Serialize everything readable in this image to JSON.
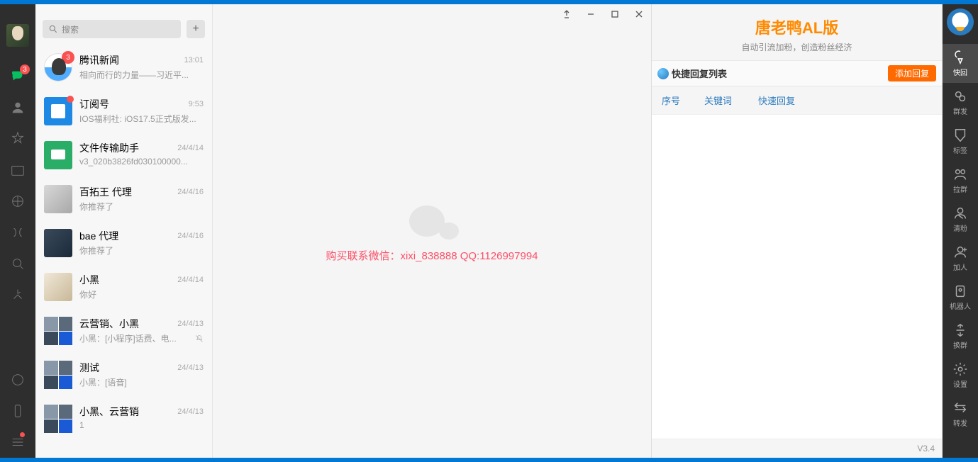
{
  "wechat_sidebar": {
    "chat_badge": "3"
  },
  "search": {
    "placeholder": "搜索"
  },
  "chats": [
    {
      "name": "腾讯新闻",
      "time": "13:01",
      "preview": "相向而行的力量——习近平...",
      "avatar": "qq",
      "badge": "3"
    },
    {
      "name": "订阅号",
      "time": "9:53",
      "preview": "IOS福利社: iOS17.5正式版发...",
      "avatar": "sub",
      "dot": true
    },
    {
      "name": "文件传输助手",
      "time": "24/4/14",
      "preview": "v3_020b3826fd030100000...",
      "avatar": "file"
    },
    {
      "name": "百拓王  代理",
      "time": "24/4/16",
      "preview": "你推荐了",
      "avatar": "photo1"
    },
    {
      "name": "bae  代理",
      "time": "24/4/16",
      "preview": "你推荐了",
      "avatar": "photo2"
    },
    {
      "name": "小黑",
      "time": "24/4/14",
      "preview": "你好",
      "avatar": "dog"
    },
    {
      "name": "云营销、小黑",
      "time": "24/4/13",
      "preview": "小黑：[小程序]话费、电...",
      "avatar": "grid",
      "mute": true
    },
    {
      "name": "测试",
      "time": "24/4/13",
      "preview": "小黑：[语音]",
      "avatar": "grid"
    },
    {
      "name": "小黑、云营销",
      "time": "24/4/13",
      "preview": "1",
      "avatar": "grid"
    }
  ],
  "watermark": "购买联系微信：xixi_838888    QQ:1126997994",
  "right_panel": {
    "title": "唐老鸭AL版",
    "subtitle": "自动引流加粉，创造粉丝经济",
    "list_label": "快捷回复列表",
    "add_btn": "添加回复",
    "cols": {
      "c1": "序号",
      "c2": "关键词",
      "c3": "快速回复"
    },
    "version": "V3.4"
  },
  "tools": [
    {
      "label": "快回",
      "active": true
    },
    {
      "label": "群发"
    },
    {
      "label": "标签"
    },
    {
      "label": "拉群"
    },
    {
      "label": "清粉"
    },
    {
      "label": "加人"
    },
    {
      "label": "机器人"
    },
    {
      "label": "换群"
    },
    {
      "label": "设置"
    },
    {
      "label": "转发"
    }
  ]
}
